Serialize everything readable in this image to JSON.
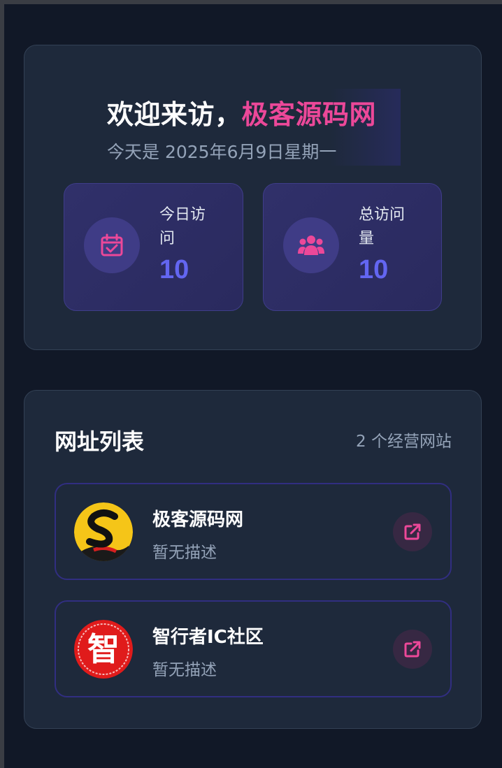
{
  "welcome": {
    "greeting": "欢迎来访，",
    "brand": "极客源码网",
    "date_text": "今天是 2025年6月9日星期一"
  },
  "stats": [
    {
      "label": "今日访问",
      "value": "10",
      "icon": "calendar-check-icon"
    },
    {
      "label": "总访问量",
      "value": "10",
      "icon": "users-icon"
    }
  ],
  "links": {
    "title": "网址列表",
    "count_text": "2 个经营网站",
    "items": [
      {
        "name": "极客源码网",
        "description": "暂无描述",
        "logo": "s-logo",
        "action_icon": "external-link-icon"
      },
      {
        "name": "智行者IC社区",
        "description": "暂无描述",
        "logo": "zhi-logo",
        "logo_text": "智",
        "action_icon": "external-link-icon"
      }
    ]
  },
  "colors": {
    "background": "#111827",
    "card": "#1e293b",
    "accent_pink": "#ec4899",
    "accent_indigo": "#6366f1",
    "muted_text": "#94a3b8"
  }
}
